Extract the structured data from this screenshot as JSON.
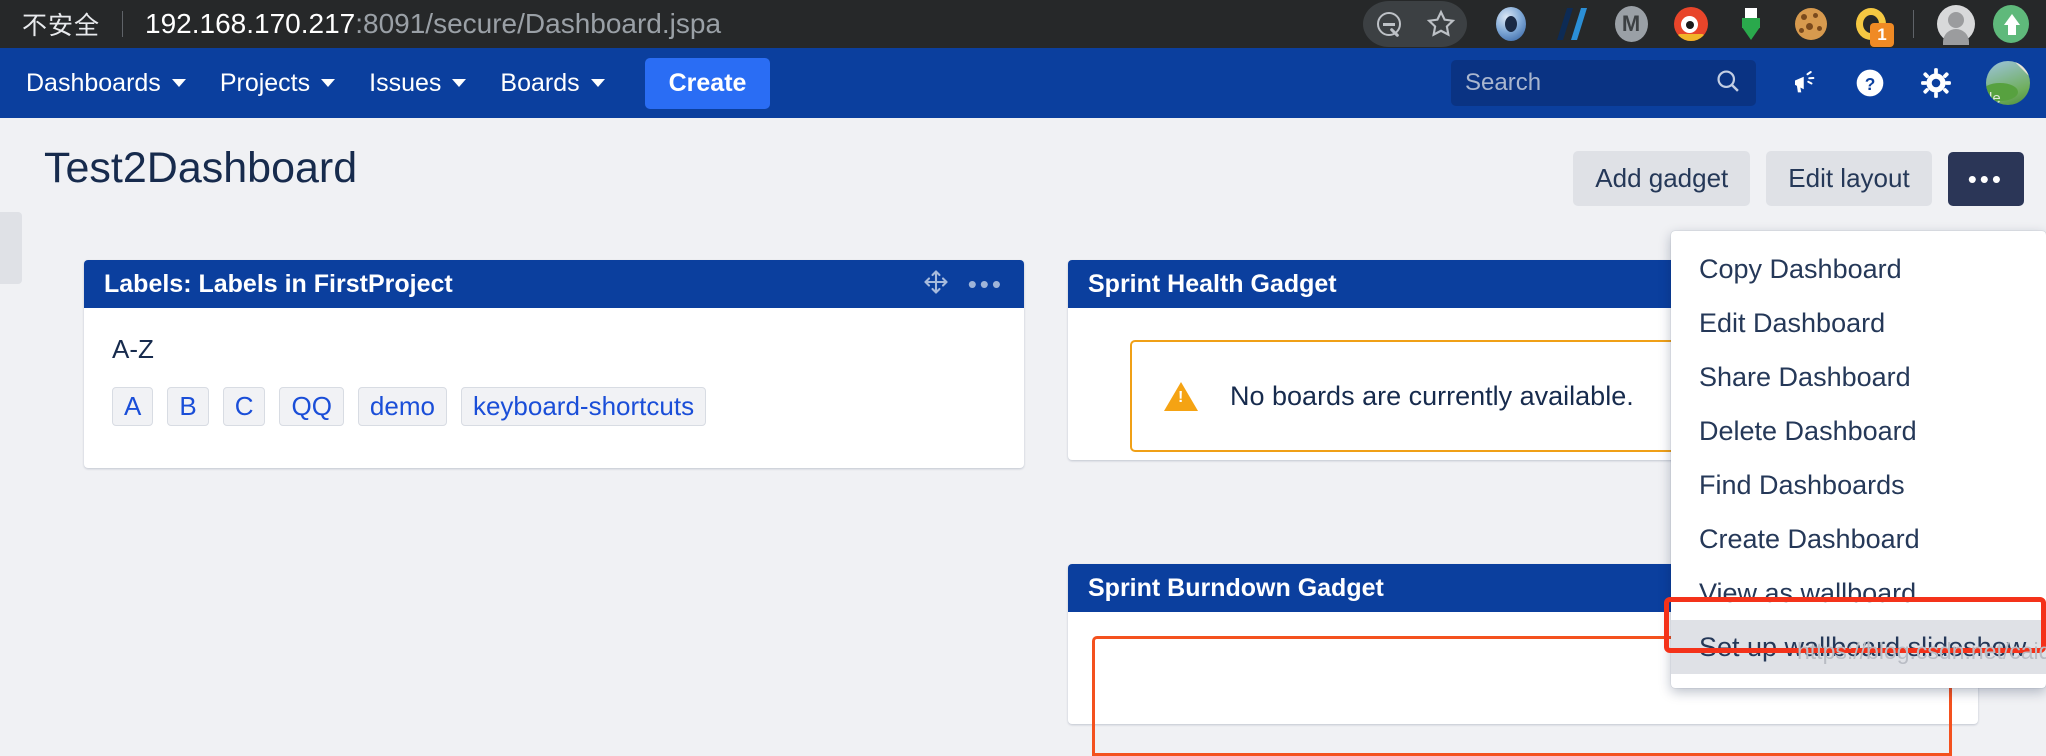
{
  "browser": {
    "security_label": "不安全",
    "url_host": "192.168.170.217",
    "url_path": ":8091/secure/Dashboard.jspa",
    "icons": [
      "zoom-out-icon",
      "bookmark-star-icon",
      "opera-extension-icon",
      "slashes-extension-icon",
      "medium-extension-icon",
      "eye-extension-icon",
      "download-extension-icon",
      "cookie-extension-icon",
      "ring-extension-icon"
    ],
    "ring_badge_count": "1",
    "profile_icon": "user-avatar-icon",
    "upload_icon": "upload-extension-icon"
  },
  "nav": {
    "items": [
      {
        "label": "Dashboards"
      },
      {
        "label": "Projects"
      },
      {
        "label": "Issues"
      },
      {
        "label": "Boards"
      }
    ],
    "create_label": "Create",
    "search_placeholder": "Search",
    "icons": [
      "search-icon",
      "announcement-icon",
      "help-icon",
      "settings-icon"
    ],
    "avatar_text": "le"
  },
  "header": {
    "title": "Test2Dashboard",
    "add_gadget_label": "Add gadget",
    "edit_layout_label": "Edit layout",
    "more_label": "•••"
  },
  "gadgets": {
    "labels": {
      "title": "Labels: Labels in FirstProject",
      "section_label": "A-Z",
      "chips": [
        "A",
        "B",
        "C",
        "QQ",
        "demo",
        "keyboard-shortcuts"
      ]
    },
    "sprint_health": {
      "title": "Sprint Health Gadget",
      "warning_text": "No boards are currently available."
    },
    "sprint_burndown": {
      "title": "Sprint Burndown Gadget"
    }
  },
  "dashboard_menu": {
    "items": [
      {
        "label": "Copy Dashboard",
        "selected": false
      },
      {
        "label": "Edit Dashboard",
        "selected": false
      },
      {
        "label": "Share Dashboard",
        "selected": false
      },
      {
        "label": "Delete Dashboard",
        "selected": false
      },
      {
        "label": "Find Dashboards",
        "selected": false
      },
      {
        "label": "Create Dashboard",
        "selected": false
      },
      {
        "label": "View as wallboard",
        "selected": false
      },
      {
        "label": "Set up wallboard slideshow",
        "selected": true
      }
    ]
  },
  "watermark": "https://blog.csdn.net/caiqiiqi",
  "colors": {
    "jira_nav_blue": "#0b3f9e",
    "create_blue": "#2a6df4",
    "link_blue": "#1a4ed8",
    "warn_orange": "#f0a017",
    "highlight_red": "#f4321a",
    "text_dark": "#172b4d",
    "page_bg": "#f0f1f4",
    "browser_bar": "#262829"
  }
}
